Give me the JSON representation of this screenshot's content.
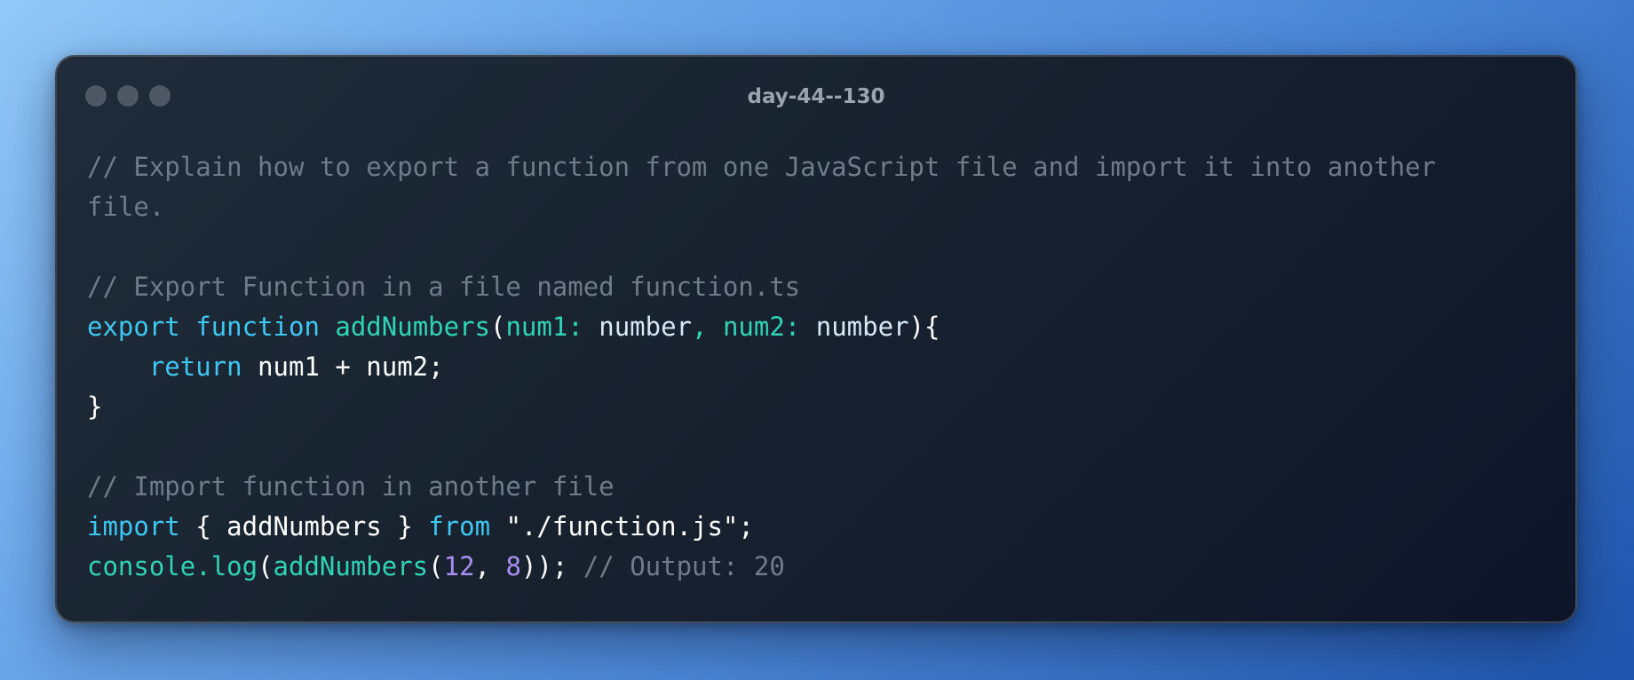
{
  "window": {
    "title": "day-44--130"
  },
  "code": {
    "line1": "// Explain how to export a function from one JavaScript file and import it into another",
    "line2": "file.",
    "line4": "// Export Function in a file named function.ts",
    "line5": {
      "kw_export": "export",
      "kw_function": "function",
      "fn_name": "addNumbers",
      "open_paren": "(",
      "param1": "num1:",
      "type1": "number",
      "comma": ",",
      "param2": "num2:",
      "type2": "number",
      "close": "){"
    },
    "line6": {
      "indent": "    ",
      "kw_return": "return",
      "expr": "num1 + num2;"
    },
    "line7": "}",
    "line9": "// Import function in another file",
    "line10": {
      "kw_import": "import",
      "brace_open": "{",
      "name": "addNumbers",
      "brace_close": "}",
      "kw_from": "from",
      "path": "\"./function.js\";"
    },
    "line11": {
      "obj": "console",
      "dot": ".",
      "method": "log",
      "open": "(",
      "fn_name": "addNumbers",
      "open2": "(",
      "arg1": "12",
      "comma": ",",
      "arg2": "8",
      "close": "));",
      "comment": "// Output: 20"
    }
  },
  "colors": {
    "comment": "#6f7b88",
    "keyword": "#3ec7f0",
    "function": "#2fd3b5",
    "number": "#a98ef2",
    "text": "#ffffff"
  }
}
